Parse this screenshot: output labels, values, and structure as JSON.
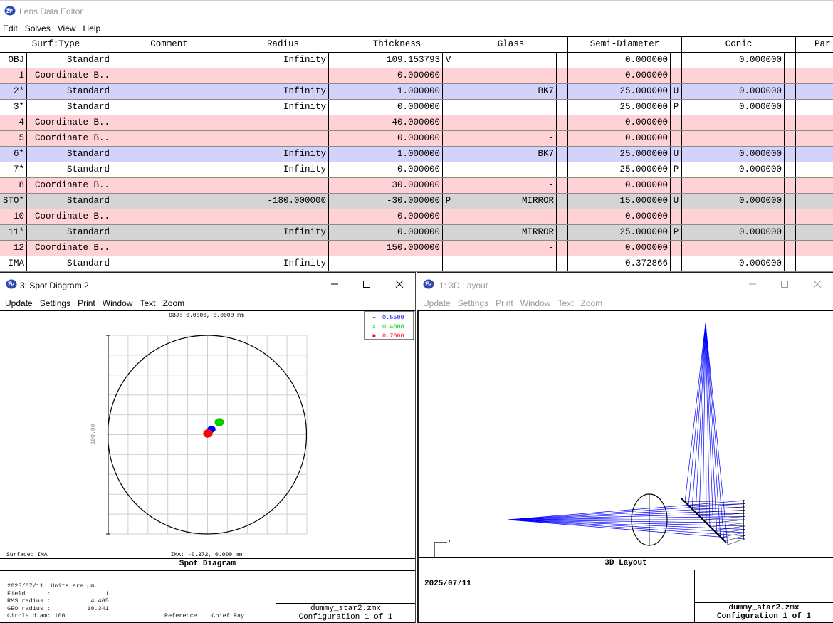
{
  "main_window": {
    "title": "Lens Data Editor",
    "menu": [
      "Edit",
      "Solves",
      "View",
      "Help"
    ]
  },
  "lens_table": {
    "headers": [
      "Surf:Type",
      "Comment",
      "Radius",
      "Thickness",
      "Glass",
      "Semi-Diameter",
      "Conic",
      "Par"
    ],
    "rows": [
      {
        "surf": "OBJ",
        "type": "Standard",
        "comment": "",
        "radius": "Infinity",
        "radius_solve": "",
        "thickness": "109.153793",
        "thickness_solve": "V",
        "glass": "",
        "glass_solve": "",
        "semi_diameter": "0.000000",
        "semi_solve": "",
        "conic": "0.000000",
        "style": "white"
      },
      {
        "surf": "1",
        "type": "Coordinate B..",
        "comment": "",
        "radius": "",
        "radius_solve": "",
        "thickness": "0.000000",
        "thickness_solve": "",
        "glass": "-",
        "glass_solve": "",
        "semi_diameter": "0.000000",
        "semi_solve": "",
        "conic": "",
        "style": "pink"
      },
      {
        "surf": "2*",
        "type": "Standard",
        "comment": "",
        "radius": "Infinity",
        "radius_solve": "",
        "thickness": "1.000000",
        "thickness_solve": "",
        "glass": "BK7",
        "glass_solve": "",
        "semi_diameter": "25.000000",
        "semi_solve": "U",
        "conic": "0.000000",
        "style": "blue"
      },
      {
        "surf": "3*",
        "type": "Standard",
        "comment": "",
        "radius": "Infinity",
        "radius_solve": "",
        "thickness": "0.000000",
        "thickness_solve": "",
        "glass": "",
        "glass_solve": "",
        "semi_diameter": "25.000000",
        "semi_solve": "P",
        "conic": "0.000000",
        "style": "white"
      },
      {
        "surf": "4",
        "type": "Coordinate B..",
        "comment": "",
        "radius": "",
        "radius_solve": "",
        "thickness": "40.000000",
        "thickness_solve": "",
        "glass": "-",
        "glass_solve": "",
        "semi_diameter": "0.000000",
        "semi_solve": "",
        "conic": "",
        "style": "pink"
      },
      {
        "surf": "5",
        "type": "Coordinate B..",
        "comment": "",
        "radius": "",
        "radius_solve": "",
        "thickness": "0.000000",
        "thickness_solve": "",
        "glass": "-",
        "glass_solve": "",
        "semi_diameter": "0.000000",
        "semi_solve": "",
        "conic": "",
        "style": "pink"
      },
      {
        "surf": "6*",
        "type": "Standard",
        "comment": "",
        "radius": "Infinity",
        "radius_solve": "",
        "thickness": "1.000000",
        "thickness_solve": "",
        "glass": "BK7",
        "glass_solve": "",
        "semi_diameter": "25.000000",
        "semi_solve": "U",
        "conic": "0.000000",
        "style": "blue"
      },
      {
        "surf": "7*",
        "type": "Standard",
        "comment": "",
        "radius": "Infinity",
        "radius_solve": "",
        "thickness": "0.000000",
        "thickness_solve": "",
        "glass": "",
        "glass_solve": "",
        "semi_diameter": "25.000000",
        "semi_solve": "P",
        "conic": "0.000000",
        "style": "white"
      },
      {
        "surf": "8",
        "type": "Coordinate B..",
        "comment": "",
        "radius": "",
        "radius_solve": "",
        "thickness": "30.000000",
        "thickness_solve": "",
        "glass": "-",
        "glass_solve": "",
        "semi_diameter": "0.000000",
        "semi_solve": "",
        "conic": "",
        "style": "pink"
      },
      {
        "surf": "STO*",
        "type": "Standard",
        "comment": "",
        "radius": "-180.000000",
        "radius_solve": "",
        "thickness": "-30.000000",
        "thickness_solve": "P",
        "glass": "MIRROR",
        "glass_solve": "",
        "semi_diameter": "15.000000",
        "semi_solve": "U",
        "conic": "0.000000",
        "style": "grey"
      },
      {
        "surf": "10",
        "type": "Coordinate B..",
        "comment": "",
        "radius": "",
        "radius_solve": "",
        "thickness": "0.000000",
        "thickness_solve": "",
        "glass": "-",
        "glass_solve": "",
        "semi_diameter": "0.000000",
        "semi_solve": "",
        "conic": "",
        "style": "pink"
      },
      {
        "surf": "11*",
        "type": "Standard",
        "comment": "",
        "radius": "Infinity",
        "radius_solve": "",
        "thickness": "0.000000",
        "thickness_solve": "",
        "glass": "MIRROR",
        "glass_solve": "",
        "semi_diameter": "25.000000",
        "semi_solve": "P",
        "conic": "0.000000",
        "style": "grey"
      },
      {
        "surf": "12",
        "type": "Coordinate B..",
        "comment": "",
        "radius": "",
        "radius_solve": "",
        "thickness": "150.000000",
        "thickness_solve": "",
        "glass": "-",
        "glass_solve": "",
        "semi_diameter": "0.000000",
        "semi_solve": "",
        "conic": "",
        "style": "pink"
      },
      {
        "surf": "IMA",
        "type": "Standard",
        "comment": "",
        "radius": "Infinity",
        "radius_solve": "",
        "thickness": "-",
        "thickness_solve": "",
        "glass": "",
        "glass_solve": "",
        "semi_diameter": "0.372866",
        "semi_solve": "",
        "conic": "0.000000",
        "style": "white"
      }
    ]
  },
  "row_colors": {
    "white": "#ffffff",
    "pink": "#ffd2d6",
    "blue": "#d2d2fa",
    "grey": "#d4d4d4"
  },
  "spot_window": {
    "title": "3: Spot Diagram 2",
    "menu": [
      "Update",
      "Settings",
      "Print",
      "Window",
      "Text",
      "Zoom"
    ],
    "obj_label": "OBJ: 0.0000, 0.0000 mm",
    "legend": [
      {
        "marker": "+",
        "label": "0.5500",
        "color": "#0000ff"
      },
      {
        "marker": "×",
        "label": "0.4000",
        "color": "#00cc00"
      },
      {
        "marker": "■",
        "label": "0.7000",
        "color": "#ff0000"
      }
    ],
    "scale_label": "100.00",
    "surface_label": "Surface: IMA",
    "ima_label": "IMA: -0.372, 0.000 mm",
    "caption": "Spot Diagram",
    "info_lines": [
      "2025/07/11  Units are µm.",
      "Field      :               1",
      "RMS radius :           4.465",
      "GEO radius :          10.341",
      "Circle diam: 100"
    ],
    "reference": "Reference  : Chief Ray",
    "filename": "dummy_star2.zmx",
    "config": "Configuration 1 of 1"
  },
  "layout_window": {
    "title": "1: 3D Layout",
    "menu": [
      "Update",
      "Settings",
      "Print",
      "Window",
      "Text",
      "Zoom"
    ],
    "caption": "3D Layout",
    "date": "2025/07/11",
    "filename": "dummy_star2.zmx",
    "config": "Configuration 1 of 1",
    "ray_color": "#0000ff"
  }
}
